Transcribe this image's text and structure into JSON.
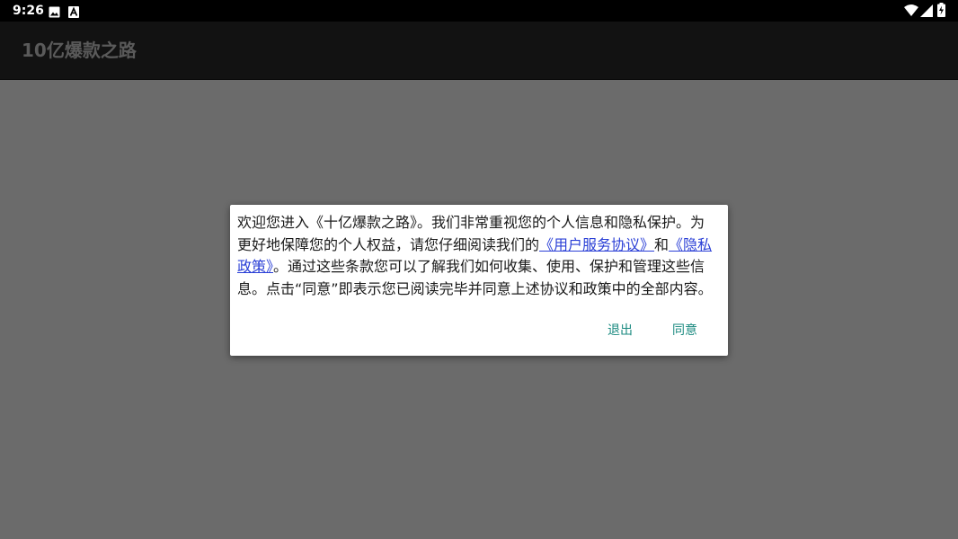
{
  "status_bar": {
    "time": "9:26",
    "icons": [
      "image-icon",
      "font-icon",
      "wifi-icon",
      "cellular-signal-icon",
      "battery-icon"
    ]
  },
  "app_bar": {
    "title": "10亿爆款之路"
  },
  "dialog": {
    "message_part1": "欢迎您进入《十亿爆款之路》。我们非常重视您的个人信息和隐私保护。为更好地保障您的个人权益，请您仔细阅读我们的",
    "link_user_agreement": "《用户服务协议》",
    "message_and": "和",
    "link_privacy_policy": "《隐私政策》",
    "message_part2": "。通过这些条款您可以了解我们如何收集、使用、保护和管理这些信息。点击“同意”即表示您已阅读完毕并同意上述协议和政策中的全部内容。",
    "exit_button": "退出",
    "agree_button": "同意"
  },
  "colors": {
    "scrim": "#6b6b6b",
    "status_bar": "#000000",
    "app_bar": "#121212",
    "link": "#2a3fd6",
    "accent": "#1b8a80"
  }
}
